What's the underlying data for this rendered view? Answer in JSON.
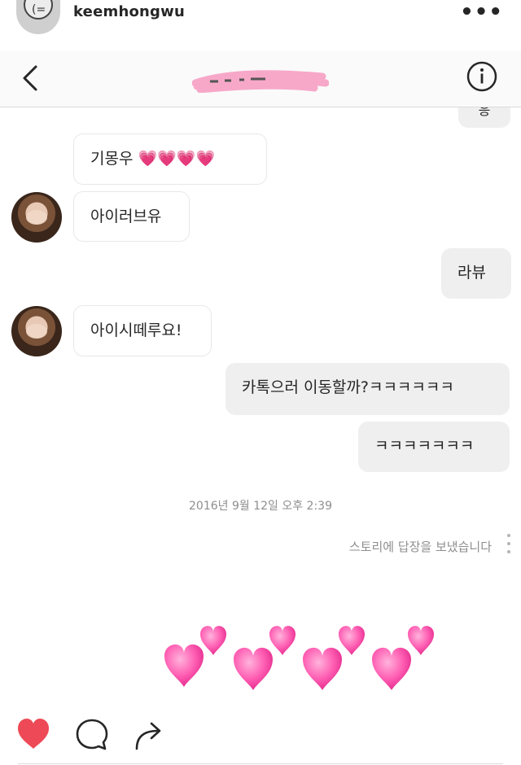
{
  "post": {
    "username": "keemhongwu",
    "more_icon": "more-horizontal-icon",
    "more_glyph": "•••"
  },
  "dm": {
    "back_icon": "chevron-left-icon",
    "info_icon": "info-icon",
    "title_redacted": true,
    "scribble_color": "#f7a8c8"
  },
  "messages": [
    {
      "side": "out",
      "text": "응",
      "partial": true
    },
    {
      "side": "in",
      "text": "기몽우 💗💗💗💗"
    },
    {
      "side": "in",
      "text": "아이러브유",
      "avatar": true
    },
    {
      "side": "out",
      "text": "라뷰"
    },
    {
      "side": "in",
      "text": "아이시떼루요!",
      "avatar": true
    },
    {
      "side": "out",
      "text": "카톡으러 이동할까?ㅋㅋㅋㅋㅋㅋ"
    },
    {
      "side": "out",
      "text": "ㅋㅋㅋㅋㅋㅋㅋ"
    }
  ],
  "timestamp": "2016년 9월 12일 오후 2:39",
  "story_reply": {
    "note": "스토리에 답장을 보냈습니다",
    "emoji": "💕",
    "emoji_color": "#ff5fb3"
  },
  "actions": {
    "like_icon": "heart-filled-icon",
    "like_color": "#ed4956",
    "comment_icon": "comment-icon",
    "share_icon": "share-icon"
  }
}
